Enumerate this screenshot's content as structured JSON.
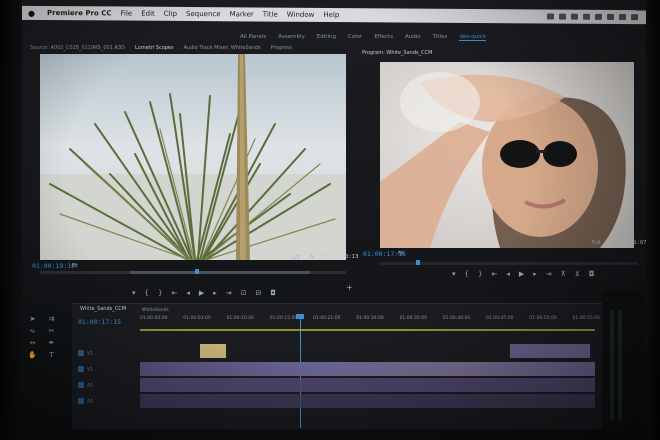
{
  "menubar": {
    "items": [
      "Premiere Pro CC",
      "File",
      "Edit",
      "Clip",
      "Sequence",
      "Marker",
      "Title",
      "Window",
      "Help"
    ]
  },
  "workspaces": {
    "items": [
      "All Panels",
      "Assembly",
      "Editing",
      "Color",
      "Effects",
      "Audio",
      "Titles",
      "dev-quick"
    ],
    "active_index": 7
  },
  "source_panel": {
    "tabs": [
      "Source: A002_C028_0119R5_001.R3D",
      "Lumetri Scopes",
      "Audio Track Mixer: WhiteSands",
      "Progress"
    ],
    "tab_prefix": "Source: A002_C028_0119R5_001.R3D",
    "timecode": "01:00:19:10",
    "fit": "Fit",
    "ratio": "1/2",
    "duration": "00:00:00:13"
  },
  "program_panel": {
    "tab": "Program: White_Sands_CCM",
    "timecode": "01:00:17:15",
    "fit": "Fit",
    "ratio": "Full",
    "duration": "00:01:07"
  },
  "timeline": {
    "tab": "White_Sands_CCM",
    "timecode": "01:00:17:15",
    "sequence_label": "WhiteSands",
    "ruler": [
      "01:00:00:00",
      "01:00:03:00",
      "01:00:10:00",
      "01:00:15:00",
      "01:00:21:00",
      "01:00:30:00",
      "01:00:35:00",
      "01:00:40:00",
      "01:00:45:00",
      "01:00:50:00",
      "01:00:55:00"
    ],
    "tracks": [
      "V1",
      "V1",
      "A1",
      "A2"
    ]
  },
  "colors": {
    "accent": "#3b8fd6",
    "video_clip": "#6e6a9a",
    "audio_clip": "#5a4f7a"
  }
}
